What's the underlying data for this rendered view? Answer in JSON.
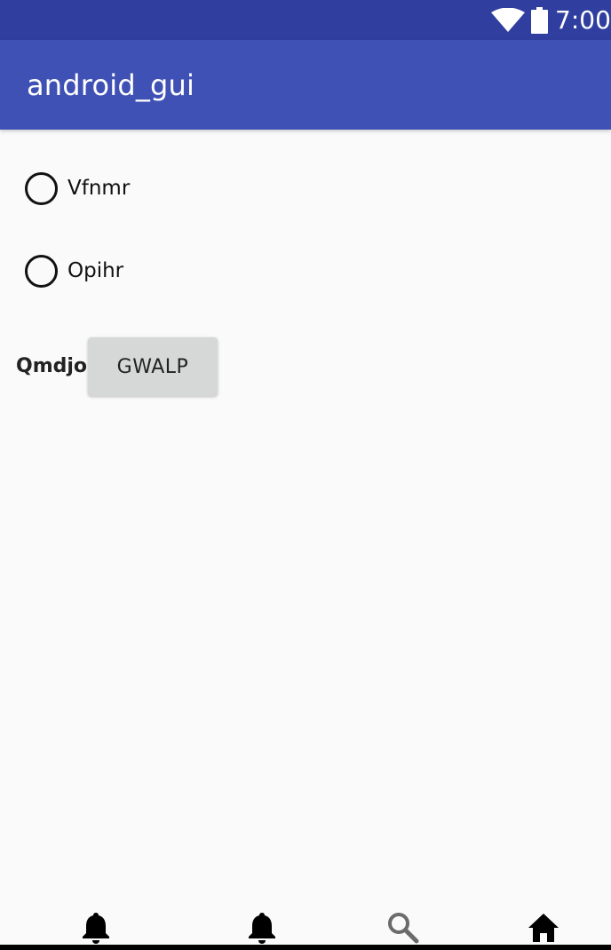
{
  "status_bar": {
    "time": "7:00",
    "wifi_icon": "wifi-icon",
    "battery_icon": "battery-icon"
  },
  "app_bar": {
    "title": "android_gui"
  },
  "radios": [
    {
      "label": "Vfnmr",
      "checked": false
    },
    {
      "label": "Opihr",
      "checked": false
    }
  ],
  "form": {
    "label": "Qmdjo",
    "button_label": "GWALP"
  },
  "bottom_nav": {
    "items": [
      {
        "icon": "bell-icon"
      },
      {
        "icon": "bell-icon"
      },
      {
        "icon": "search-icon"
      },
      {
        "icon": "home-icon"
      }
    ]
  },
  "colors": {
    "status_bar": "#303f9f",
    "app_bar": "#3f51b5",
    "background": "#fafafa",
    "button": "#d6d7d7"
  }
}
